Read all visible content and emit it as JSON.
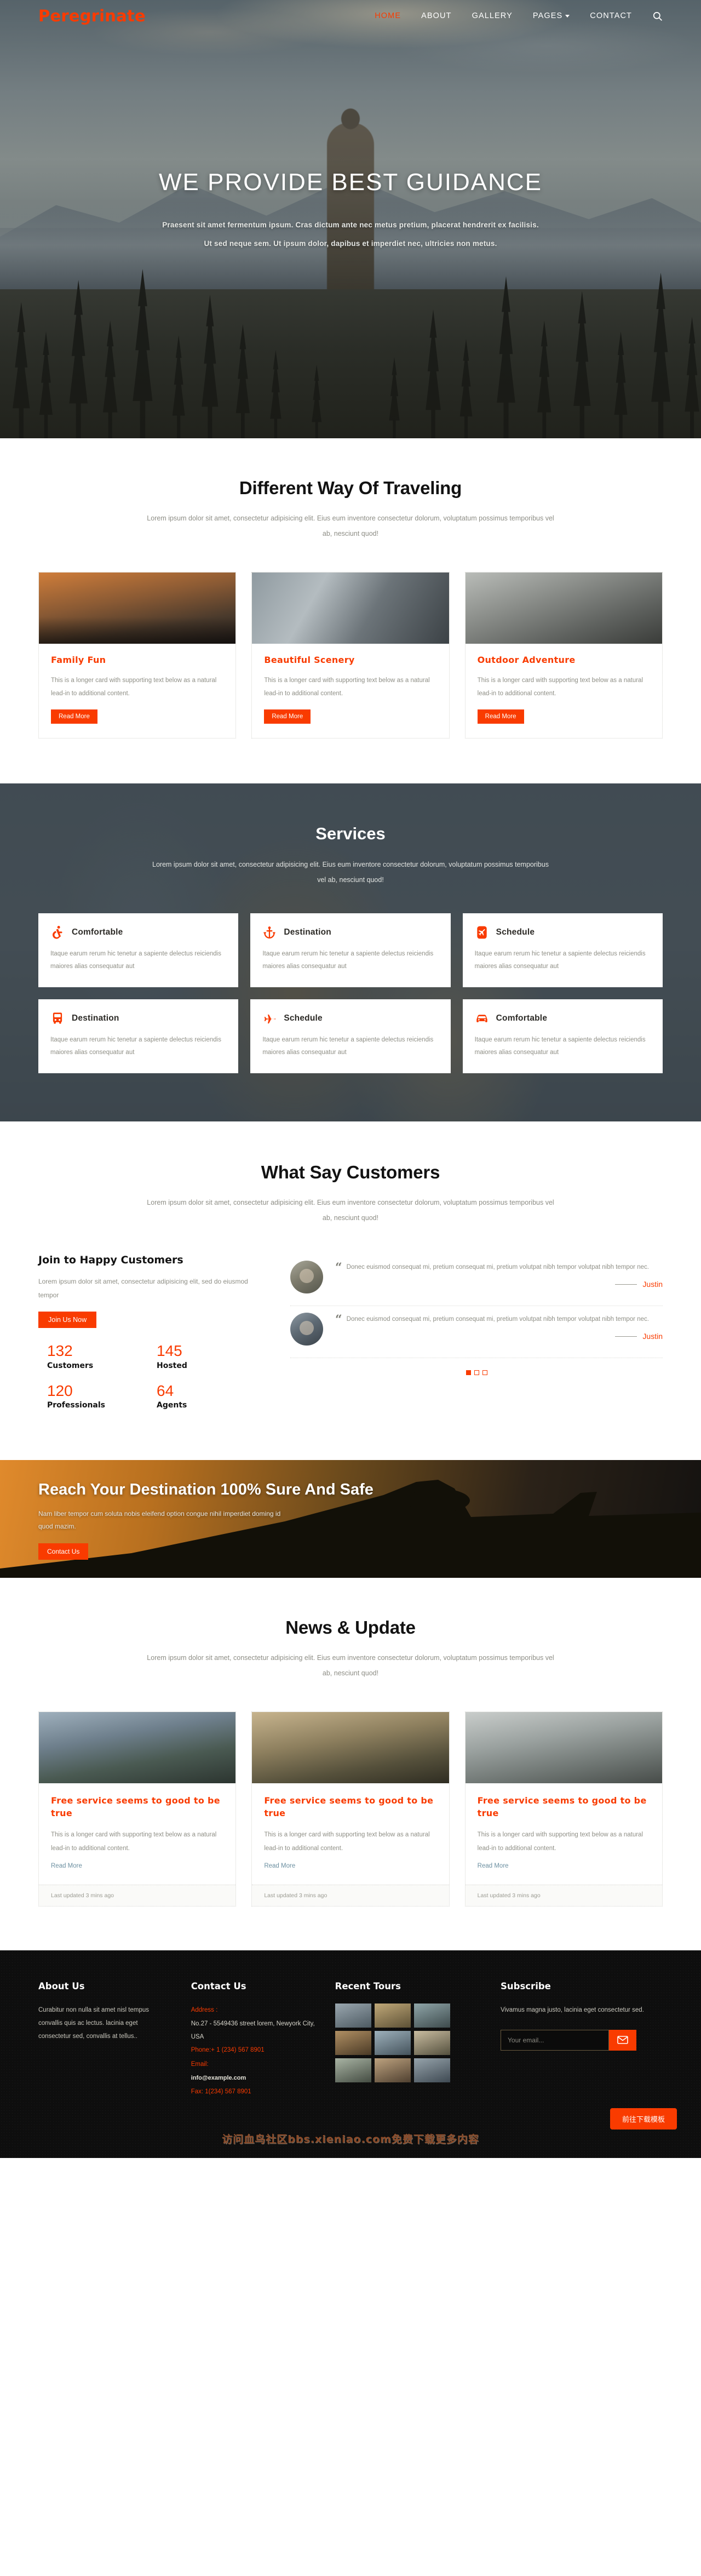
{
  "brand": {
    "name": "Peregrinate"
  },
  "nav": {
    "items": [
      {
        "label": "HOME",
        "active": true
      },
      {
        "label": "ABOUT",
        "active": false
      },
      {
        "label": "GALLERY",
        "active": false
      },
      {
        "label": "PAGES",
        "active": false,
        "has_caret": true
      },
      {
        "label": "CONTACT",
        "active": false
      }
    ],
    "search_icon": "search-icon"
  },
  "hero": {
    "title": "WE PROVIDE BEST GUIDANCE",
    "subtitle": "Praesent sit amet fermentum ipsum. Cras dictum ante nec metus pretium, placerat hendrerit ex facilisis. Ut sed neque sem. Ut ipsum dolor, dapibus et imperdiet nec, ultricies non metus."
  },
  "travel": {
    "title": "Different Way Of Traveling",
    "subtitle": "Lorem ipsum dolor sit amet, consectetur adipisicing elit. Eius eum inventore consectetur dolorum, voluptatum possimus temporibus vel ab, nesciunt quod!",
    "cards": [
      {
        "title": "Family Fun",
        "text": "This is a longer card with supporting text below as a natural lead-in to additional content.",
        "button": "Read More"
      },
      {
        "title": "Beautiful Scenery",
        "text": "This is a longer card with supporting text below as a natural lead-in to additional content.",
        "button": "Read More"
      },
      {
        "title": "Outdoor Adventure",
        "text": "This is a longer card with supporting text below as a natural lead-in to additional content.",
        "button": "Read More"
      }
    ]
  },
  "services": {
    "title": "Services",
    "subtitle": "Lorem ipsum dolor sit amet, consectetur adipisicing elit. Eius eum inventore consectetur dolorum, voluptatum possimus temporibus vel ab, nesciunt quod!",
    "items": [
      {
        "title": "Comfortable",
        "icon": "wheelchair-icon",
        "text": "Itaque earum rerum hic tenetur a sapiente delectus reiciendis maiores alias consequatur aut"
      },
      {
        "title": "Destination",
        "icon": "anchor-icon",
        "text": "Itaque earum rerum hic tenetur a sapiente delectus reiciendis maiores alias consequatur aut"
      },
      {
        "title": "Schedule",
        "icon": "plane-square-icon",
        "text": "Itaque earum rerum hic tenetur a sapiente delectus reiciendis maiores alias consequatur aut"
      },
      {
        "title": "Destination",
        "icon": "bus-icon",
        "text": "Itaque earum rerum hic tenetur a sapiente delectus reiciendis maiores alias consequatur aut"
      },
      {
        "title": "Schedule",
        "icon": "jet-icon",
        "text": "Itaque earum rerum hic tenetur a sapiente delectus reiciendis maiores alias consequatur aut"
      },
      {
        "title": "Comfortable",
        "icon": "car-icon",
        "text": "Itaque earum rerum hic tenetur a sapiente delectus reiciendis maiores alias consequatur aut"
      }
    ]
  },
  "customers": {
    "title": "What Say Customers",
    "subtitle": "Lorem ipsum dolor sit amet, consectetur adipisicing elit. Eius eum inventore consectetur dolorum, voluptatum possimus temporibus vel ab, nesciunt quod!",
    "join_title": "Join to Happy Customers",
    "join_text": "Lorem ipsum dolor sit amet, consectetur adipisicing elit, sed do eiusmod tempor",
    "join_button": "Join Us Now",
    "stats": [
      {
        "num": "132",
        "label": "Customers"
      },
      {
        "num": "145",
        "label": "Hosted"
      },
      {
        "num": "120",
        "label": "Professionals"
      },
      {
        "num": "64",
        "label": "Agents"
      }
    ],
    "testimonials": [
      {
        "quote": "Donec euismod consequat mi, pretium consequat mi, pretium volutpat nibh tempor volutpat nibh tempor nec.",
        "author": "Justin"
      },
      {
        "quote": "Donec euismod consequat mi, pretium consequat mi, pretium volutpat nibh tempor volutpat nibh tempor nec.",
        "author": "Justin"
      }
    ],
    "pagination": [
      "active",
      "inactive",
      "inactive"
    ]
  },
  "cta": {
    "title": "Reach Your Destination 100% Sure And Safe",
    "text": "Nam liber tempor cum soluta nobis eleifend option congue nihil imperdiet doming id quod mazim.",
    "button": "Contact Us"
  },
  "news": {
    "title": "News & Update",
    "subtitle": "Lorem ipsum dolor sit amet, consectetur adipisicing elit. Eius eum inventore consectetur dolorum, voluptatum possimus temporibus vel ab, nesciunt quod!",
    "cards": [
      {
        "title": "Free service seems to good to be true",
        "text": "This is a longer card with supporting text below as a natural lead-in to additional content.",
        "link": "Read More",
        "footer": "Last updated 3 mins ago"
      },
      {
        "title": "Free service seems to good to be true",
        "text": "This is a longer card with supporting text below as a natural lead-in to additional content.",
        "link": "Read More",
        "footer": "Last updated 3 mins ago"
      },
      {
        "title": "Free service seems to good to be true",
        "text": "This is a longer card with supporting text below as a natural lead-in to additional content.",
        "link": "Read More",
        "footer": "Last updated 3 mins ago"
      }
    ]
  },
  "footer": {
    "about": {
      "title": "About Us",
      "text": "Curabitur non nulla sit amet nisl tempus convallis quis ac lectus. lacinia eget consectetur sed, convallis at tellus.."
    },
    "contact": {
      "title": "Contact Us",
      "address_label": "Address :",
      "address_value": "No.27 - 5549436 street lorem, Newyork City, USA",
      "phone": "Phone:+ 1 (234) 567 8901",
      "email_label": "Email:",
      "email_value": "info@example.com",
      "fax": "Fax: 1(234) 567 8901"
    },
    "tours": {
      "title": "Recent Tours"
    },
    "subscribe": {
      "title": "Subscribe",
      "text": "Vivamus magna justo, lacinia eget consectetur sed.",
      "placeholder": "Your email...",
      "submit_icon": "envelope-icon"
    },
    "watermark": "访问血鸟社区bbs.xieniao.com免费下载更多内容",
    "download_button": "前往下载模板"
  },
  "colors": {
    "accent": "#f93b00",
    "dark": "#0e0e0e",
    "muted": "#8f8f86"
  }
}
